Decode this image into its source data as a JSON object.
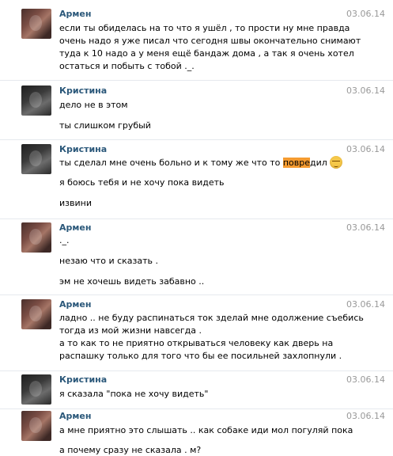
{
  "messages": [
    {
      "author": "Армен",
      "date": "03.06.14",
      "lines": [
        "если ты обиделась на то что я ушёл , то прости ну мне правда",
        "очень надо я уже писал что сегодня швы окончательно снимают",
        "туда к 10 надо а у меня ещё бандаж дома , а так я очень хотел",
        "остаться и побыть с тобой ._."
      ]
    },
    {
      "author": "Кристина",
      "date": "03.06.14",
      "lines": [
        "дело не в этом",
        "ты слишком грубый"
      ]
    },
    {
      "author": "Кристина",
      "date": "03.06.14",
      "line1_before": "ты сделал мне очень больно и к тому же что то ",
      "line1_highlight": "повре",
      "line1_after": "дил",
      "emoji": "pensive-face-emoji",
      "lines": [
        "я боюсь тебя и не хочу пока видеть",
        "извини"
      ]
    },
    {
      "author": "Армен",
      "date": "03.06.14",
      "lines": [
        "._.",
        "незаю что и сказать .",
        "эм не хочешь видеть забавно .."
      ]
    },
    {
      "author": "Армен",
      "date": "03.06.14",
      "lines": [
        "ладно .. не буду распинаться ток зделай мне одолжение съебись",
        "тогда из мой жизни навсегда .",
        "а то как то не приятно открываться человеку как дверь на",
        "распашку только для того что бы ее посильней захлопнули ."
      ]
    },
    {
      "author": "Кристина",
      "date": "03.06.14",
      "lines": [
        "я сказала \"пока не хочу видеть\""
      ]
    },
    {
      "author": "Армен",
      "date": "03.06.14",
      "lines": [
        "а мне приятно это слышать .. как собаке иди мол погуляй пока",
        "а почему сразу не сказала . м?"
      ]
    }
  ]
}
